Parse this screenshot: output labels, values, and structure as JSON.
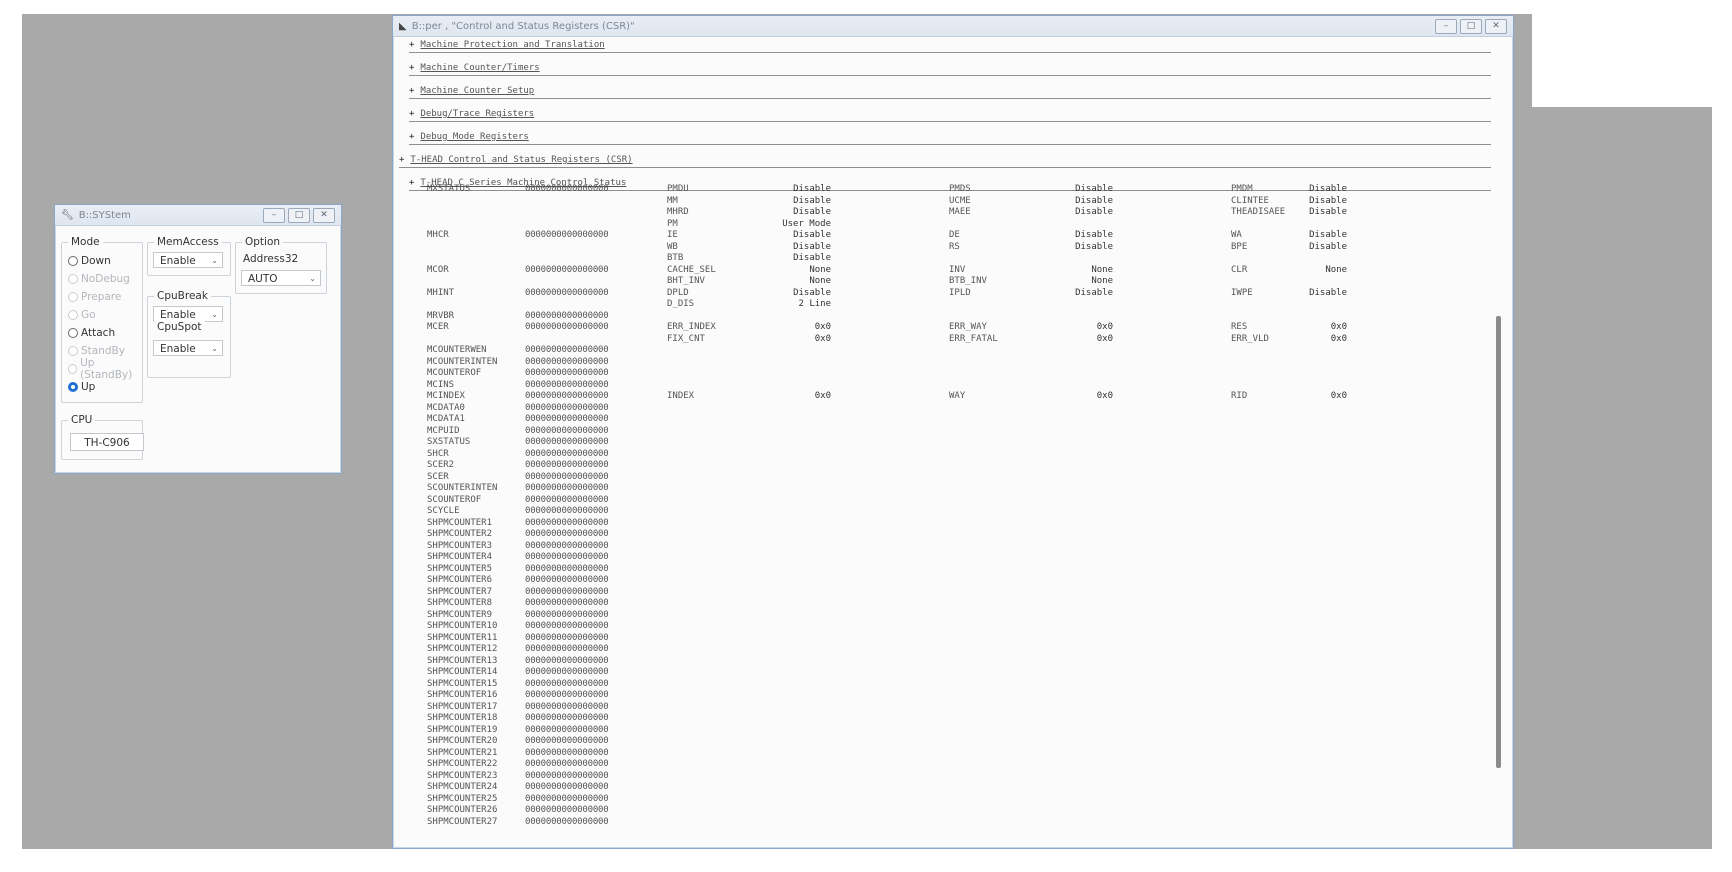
{
  "sys_window": {
    "title": "B::SYStem",
    "mode": {
      "label": "Mode",
      "options": [
        {
          "label": "Down",
          "enabled": true,
          "selected": false
        },
        {
          "label": "NoDebug",
          "enabled": false,
          "selected": false
        },
        {
          "label": "Prepare",
          "enabled": false,
          "selected": false
        },
        {
          "label": "Go",
          "enabled": false,
          "selected": false
        },
        {
          "label": "Attach",
          "enabled": true,
          "selected": false
        },
        {
          "label": "StandBy",
          "enabled": false,
          "selected": false
        },
        {
          "label": "Up (StandBy)",
          "enabled": false,
          "selected": false
        },
        {
          "label": "Up",
          "enabled": true,
          "selected": true
        }
      ]
    },
    "memaccess": {
      "label": "MemAccess",
      "value": "Enable"
    },
    "cpubreak": {
      "label": "CpuBreak",
      "value": "Enable"
    },
    "cpuspot": {
      "label": "CpuSpot",
      "value": "Enable"
    },
    "option": {
      "label": "Option",
      "address_label": "Address32",
      "address_value": "AUTO"
    },
    "cpu": {
      "label": "CPU",
      "value": "TH-C906"
    }
  },
  "per_window": {
    "title": "B::per , \"Control and Status Registers (CSR)\"",
    "sections": [
      {
        "label": "Machine Protection and Translation",
        "level": 1
      },
      {
        "label": "Machine Counter/Timers",
        "level": 1
      },
      {
        "label": "Machine Counter Setup",
        "level": 1
      },
      {
        "label": "Debug/Trace Registers",
        "level": 1
      },
      {
        "label": "Debug Mode Registers",
        "level": 1
      },
      {
        "label": "T-HEAD Control and Status Registers (CSR)",
        "level": 0
      },
      {
        "label": "T-HEAD C Series Machine Control Status",
        "level": 1
      }
    ],
    "zero_value": "0000000000000000",
    "registers": [
      {
        "name": "MXSTATUS",
        "row": 0
      },
      {
        "name": "MHCR",
        "row": 4
      },
      {
        "name": "MCOR",
        "row": 7
      },
      {
        "name": "MHINT",
        "row": 9
      },
      {
        "name": "MRVBR",
        "row": 11
      },
      {
        "name": "MCER",
        "row": 12
      },
      {
        "name": "MCOUNTERWEN",
        "row": 14
      },
      {
        "name": "MCOUNTERINTEN",
        "row": 15
      },
      {
        "name": "MCOUNTEROF",
        "row": 16
      },
      {
        "name": "MCINS",
        "row": 17
      },
      {
        "name": "MCINDEX",
        "row": 18
      },
      {
        "name": "MCDATA0",
        "row": 19
      },
      {
        "name": "MCDATA1",
        "row": 20
      },
      {
        "name": "MCPUID",
        "row": 21
      },
      {
        "name": "SXSTATUS",
        "row": 22
      },
      {
        "name": "SHCR",
        "row": 23
      },
      {
        "name": "SCER2",
        "row": 24
      },
      {
        "name": "SCER",
        "row": 25
      },
      {
        "name": "SCOUNTERINTEN",
        "row": 26
      },
      {
        "name": "SCOUNTEROF",
        "row": 27
      },
      {
        "name": "SCYCLE",
        "row": 28
      },
      {
        "name": "SHPMCOUNTER1",
        "row": 29
      },
      {
        "name": "SHPMCOUNTER2",
        "row": 30
      },
      {
        "name": "SHPMCOUNTER3",
        "row": 31
      },
      {
        "name": "SHPMCOUNTER4",
        "row": 32
      },
      {
        "name": "SHPMCOUNTER5",
        "row": 33
      },
      {
        "name": "SHPMCOUNTER6",
        "row": 34
      },
      {
        "name": "SHPMCOUNTER7",
        "row": 35
      },
      {
        "name": "SHPMCOUNTER8",
        "row": 36
      },
      {
        "name": "SHPMCOUNTER9",
        "row": 37
      },
      {
        "name": "SHPMCOUNTER10",
        "row": 38
      },
      {
        "name": "SHPMCOUNTER11",
        "row": 39
      },
      {
        "name": "SHPMCOUNTER12",
        "row": 40
      },
      {
        "name": "SHPMCOUNTER13",
        "row": 41
      },
      {
        "name": "SHPMCOUNTER14",
        "row": 42
      },
      {
        "name": "SHPMCOUNTER15",
        "row": 43
      },
      {
        "name": "SHPMCOUNTER16",
        "row": 44
      },
      {
        "name": "SHPMCOUNTER17",
        "row": 45
      },
      {
        "name": "SHPMCOUNTER18",
        "row": 46
      },
      {
        "name": "SHPMCOUNTER19",
        "row": 47
      },
      {
        "name": "SHPMCOUNTER20",
        "row": 48
      },
      {
        "name": "SHPMCOUNTER21",
        "row": 49
      },
      {
        "name": "SHPMCOUNTER22",
        "row": 50
      },
      {
        "name": "SHPMCOUNTER23",
        "row": 51
      },
      {
        "name": "SHPMCOUNTER24",
        "row": 52
      },
      {
        "name": "SHPMCOUNTER25",
        "row": 53
      },
      {
        "name": "SHPMCOUNTER26",
        "row": 54
      },
      {
        "name": "SHPMCOUNTER27",
        "row": 55
      }
    ],
    "fields": [
      {
        "row": 0,
        "col": 0,
        "name": "PMDU",
        "value": "Disable"
      },
      {
        "row": 0,
        "col": 1,
        "name": "PMDS",
        "value": "Disable"
      },
      {
        "row": 0,
        "col": 2,
        "name": "PMDM",
        "value": "Disable"
      },
      {
        "row": 1,
        "col": 0,
        "name": "MM",
        "value": "Disable"
      },
      {
        "row": 1,
        "col": 1,
        "name": "UCME",
        "value": "Disable"
      },
      {
        "row": 1,
        "col": 2,
        "name": "CLINTEE",
        "value": "Disable"
      },
      {
        "row": 2,
        "col": 0,
        "name": "MHRD",
        "value": "Disable"
      },
      {
        "row": 2,
        "col": 1,
        "name": "MAEE",
        "value": "Disable"
      },
      {
        "row": 2,
        "col": 2,
        "name": "THEADISAEE",
        "value": "Disable"
      },
      {
        "row": 3,
        "col": 0,
        "name": "PM",
        "value": "User Mode"
      },
      {
        "row": 4,
        "col": 0,
        "name": "IE",
        "value": "Disable"
      },
      {
        "row": 4,
        "col": 1,
        "name": "DE",
        "value": "Disable"
      },
      {
        "row": 4,
        "col": 2,
        "name": "WA",
        "value": "Disable"
      },
      {
        "row": 5,
        "col": 0,
        "name": "WB",
        "value": "Disable"
      },
      {
        "row": 5,
        "col": 1,
        "name": "RS",
        "value": "Disable"
      },
      {
        "row": 5,
        "col": 2,
        "name": "BPE",
        "value": "Disable"
      },
      {
        "row": 6,
        "col": 0,
        "name": "BTB",
        "value": "Disable"
      },
      {
        "row": 7,
        "col": 0,
        "name": "CACHE_SEL",
        "value": "None"
      },
      {
        "row": 7,
        "col": 1,
        "name": "INV",
        "value": "None"
      },
      {
        "row": 7,
        "col": 2,
        "name": "CLR",
        "value": "None"
      },
      {
        "row": 8,
        "col": 0,
        "name": "BHT_INV",
        "value": "None"
      },
      {
        "row": 8,
        "col": 1,
        "name": "BTB_INV",
        "value": "None"
      },
      {
        "row": 9,
        "col": 0,
        "name": "DPLD",
        "value": "Disable"
      },
      {
        "row": 9,
        "col": 1,
        "name": "IPLD",
        "value": "Disable"
      },
      {
        "row": 9,
        "col": 2,
        "name": "IWPE",
        "value": "Disable"
      },
      {
        "row": 10,
        "col": 0,
        "name": "D_DIS",
        "value": "2 Line"
      },
      {
        "row": 12,
        "col": 0,
        "name": "ERR_INDEX",
        "value": "0x0"
      },
      {
        "row": 12,
        "col": 1,
        "name": "ERR_WAY",
        "value": "0x0"
      },
      {
        "row": 12,
        "col": 2,
        "name": "RES",
        "value": "0x0"
      },
      {
        "row": 13,
        "col": 0,
        "name": "FIX_CNT",
        "value": "0x0"
      },
      {
        "row": 13,
        "col": 1,
        "name": "ERR_FATAL",
        "value": "0x0"
      },
      {
        "row": 13,
        "col": 2,
        "name": "ERR_VLD",
        "value": "0x0"
      },
      {
        "row": 18,
        "col": 0,
        "name": "INDEX",
        "value": "0x0"
      },
      {
        "row": 18,
        "col": 1,
        "name": "WAY",
        "value": "0x0"
      },
      {
        "row": 18,
        "col": 2,
        "name": "RID",
        "value": "0x0"
      }
    ]
  }
}
